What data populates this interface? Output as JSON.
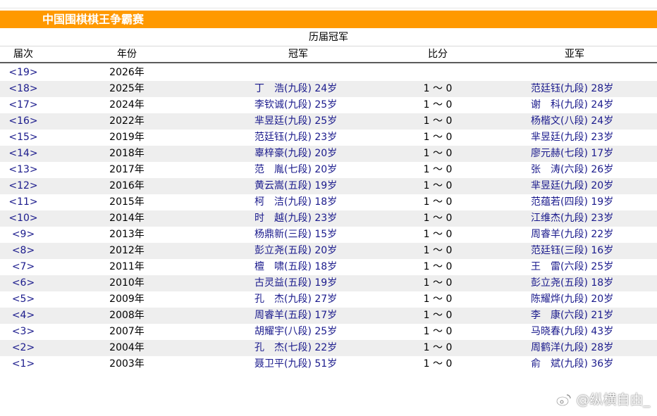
{
  "title": "中国围棋棋王争霸赛",
  "subtitle": "历届冠军",
  "columns": {
    "edition": "届次",
    "year": "年份",
    "champion": "冠军",
    "score": "比分",
    "runner_up": "亚军"
  },
  "rows": [
    {
      "edition": "<19>",
      "year": "2026年",
      "champion": "",
      "score": "",
      "runner_up": ""
    },
    {
      "edition": "<18>",
      "year": "2025年",
      "champion": "丁　浩(九段) 24岁",
      "score": "1 ～ 0",
      "runner_up": "范廷钰(九段) 28岁"
    },
    {
      "edition": "<17>",
      "year": "2024年",
      "champion": "李钦诚(九段) 25岁",
      "score": "1 ～ 0",
      "runner_up": "谢　科(九段) 24岁"
    },
    {
      "edition": "<16>",
      "year": "2022年",
      "champion": "芈昱廷(九段) 25岁",
      "score": "1 ～ 0",
      "runner_up": "杨楷文(八段) 24岁"
    },
    {
      "edition": "<15>",
      "year": "2019年",
      "champion": "范廷钰(九段) 23岁",
      "score": "1 ～ 0",
      "runner_up": "芈昱廷(九段) 23岁"
    },
    {
      "edition": "<14>",
      "year": "2018年",
      "champion": "辜梓豪(九段) 20岁",
      "score": "1 ～ 0",
      "runner_up": "廖元赫(七段) 17岁"
    },
    {
      "edition": "<13>",
      "year": "2017年",
      "champion": "范　胤(七段) 20岁",
      "score": "1 ～ 0",
      "runner_up": "张　涛(六段) 26岁"
    },
    {
      "edition": "<12>",
      "year": "2016年",
      "champion": "黄云嵩(五段) 19岁",
      "score": "1 ～ 0",
      "runner_up": "芈昱廷(九段) 20岁"
    },
    {
      "edition": "<11>",
      "year": "2015年",
      "champion": "柯　洁(九段) 18岁",
      "score": "1 ～ 0",
      "runner_up": "范蕴若(四段) 19岁"
    },
    {
      "edition": "<10>",
      "year": "2014年",
      "champion": "时　越(九段) 23岁",
      "score": "1 ～ 0",
      "runner_up": "江维杰(九段) 23岁"
    },
    {
      "edition": "<9>",
      "year": "2013年",
      "champion": "杨鼎新(三段) 15岁",
      "score": "1 ～ 0",
      "runner_up": "周睿羊(九段) 22岁"
    },
    {
      "edition": "<8>",
      "year": "2012年",
      "champion": "彭立尧(五段) 20岁",
      "score": "1 ～ 0",
      "runner_up": "范廷钰(三段) 16岁"
    },
    {
      "edition": "<7>",
      "year": "2011年",
      "champion": "檀　啸(五段) 18岁",
      "score": "1 ～ 0",
      "runner_up": "王　雷(六段) 25岁"
    },
    {
      "edition": "<6>",
      "year": "2010年",
      "champion": "古灵益(五段) 19岁",
      "score": "1 ～ 0",
      "runner_up": "彭立尧(五段) 18岁"
    },
    {
      "edition": "<5>",
      "year": "2009年",
      "champion": "孔　杰(九段) 27岁",
      "score": "1 ～ 0",
      "runner_up": "陈耀烨(九段) 20岁"
    },
    {
      "edition": "<4>",
      "year": "2008年",
      "champion": "周睿羊(五段) 17岁",
      "score": "1 ～ 0",
      "runner_up": "李　康(六段) 21岁"
    },
    {
      "edition": "<3>",
      "year": "2007年",
      "champion": "胡耀宇(八段) 25岁",
      "score": "1 ～ 0",
      "runner_up": "马晓春(九段) 43岁"
    },
    {
      "edition": "<2>",
      "year": "2004年",
      "champion": "孔　杰(七段) 22岁",
      "score": "1 ～ 0",
      "runner_up": "周鹤洋(九段) 28岁"
    },
    {
      "edition": "<1>",
      "year": "2003年",
      "champion": "聂卫平(九段) 51岁",
      "score": "1 ～ 0",
      "runner_up": "俞　斌(九段) 36岁"
    }
  ],
  "watermark": "@纵横自由_",
  "colors": {
    "title_bar": "#ff9900",
    "alt_row": "#eeeeee",
    "link_text": "#1a1a8c"
  }
}
